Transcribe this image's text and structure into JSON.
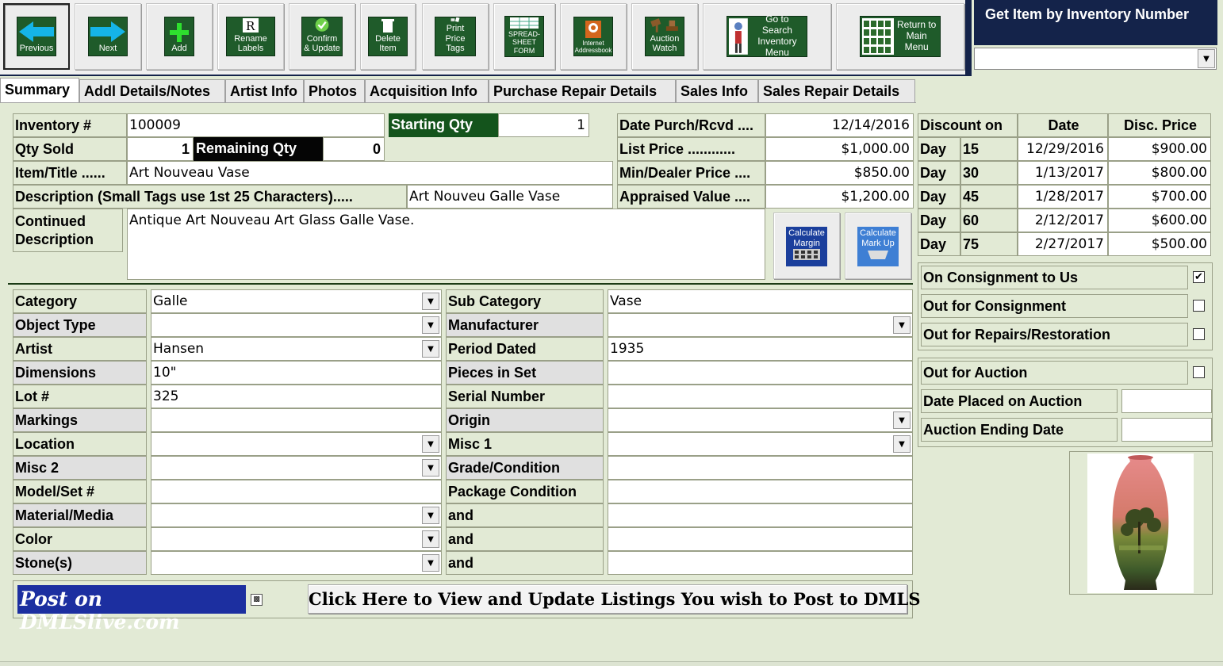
{
  "toolbar": {
    "buttons": [
      {
        "label": "Previous"
      },
      {
        "label": "Next"
      },
      {
        "label": "Add"
      },
      {
        "label": "Rename\nLabels"
      },
      {
        "label": "Confirm\n& Update"
      },
      {
        "label": "Delete\nItem"
      },
      {
        "label": "Print\nPrice Tags"
      },
      {
        "label": "SPREAD-\nSHEET\nFORM"
      },
      {
        "label": "Internet\nAddressbook"
      },
      {
        "label": "Auction\nWatch"
      },
      {
        "label": "Go to Search\nInventory\nMenu"
      },
      {
        "label": "Return to\nMain\nMenu"
      }
    ]
  },
  "get_item": {
    "title": "Get Item by Inventory Number",
    "value": ""
  },
  "tabs": [
    "Summary",
    "Addl Details/Notes",
    "Artist Info",
    "Photos",
    "Acquisition Info",
    "Purchase Repair Details",
    "Sales Info",
    "Sales Repair Details"
  ],
  "summary": {
    "inventory_label": "Inventory #",
    "inventory_value": "100009",
    "starting_qty_label": "Starting Qty",
    "starting_qty_value": "1",
    "qty_sold_label": "Qty Sold",
    "qty_sold_value": "1",
    "remaining_qty_label": "Remaining Qty",
    "remaining_qty_value": "0",
    "item_title_label": "Item/Title ......",
    "item_title_value": "Art Nouveau Vase",
    "description_label": "Description (Small Tags use 1st 25 Characters).....",
    "description_value": "Art Nouveu Galle Vase",
    "continued_label": "Continued\nDescription",
    "continued_value": "Antique Art Nouveau Art Glass Galle Vase.",
    "date_purch_label": "Date Purch/Rcvd ....",
    "date_purch_value": "12/14/2016",
    "list_price_label": "List  Price ............",
    "list_price_value": "$1,000.00",
    "min_price_label": "Min/Dealer Price ....",
    "min_price_value": "$850.00",
    "appraised_label": "Appraised Value ....",
    "appraised_value": "$1,200.00",
    "calc_margin": "Calculate\nMargin",
    "calc_markup": "Calculate\nMark Up"
  },
  "discount": {
    "headers": [
      "Discount on",
      "Date",
      "Disc. Price"
    ],
    "rows": [
      {
        "day_label": "Day",
        "days": "15",
        "date": "12/29/2016",
        "price": "$900.00"
      },
      {
        "day_label": "Day",
        "days": "30",
        "date": "1/13/2017",
        "price": "$800.00"
      },
      {
        "day_label": "Day",
        "days": "45",
        "date": "1/28/2017",
        "price": "$700.00"
      },
      {
        "day_label": "Day",
        "days": "60",
        "date": "2/12/2017",
        "price": "$600.00"
      },
      {
        "day_label": "Day",
        "days": "75",
        "date": "2/27/2017",
        "price": "$500.00"
      }
    ]
  },
  "status": {
    "on_consignment": {
      "label": "On Consignment to Us",
      "checked": "✔"
    },
    "out_consignment": {
      "label": "Out for Consignment",
      "checked": ""
    },
    "out_repairs": {
      "label": "Out for Repairs/Restoration",
      "checked": ""
    },
    "out_auction": {
      "label": "Out for Auction",
      "checked": ""
    },
    "date_placed_label": "Date Placed on Auction",
    "date_placed_value": "",
    "auction_end_label": "Auction Ending Date",
    "auction_end_value": ""
  },
  "details_left": [
    {
      "label": "Category",
      "value": "Galle",
      "combo": true
    },
    {
      "label": "Object Type",
      "value": "",
      "combo": true
    },
    {
      "label": "Artist",
      "value": "Hansen",
      "combo": true
    },
    {
      "label": "Dimensions",
      "value": "10\"",
      "combo": false
    },
    {
      "label": "Lot #",
      "value": "325",
      "combo": false
    },
    {
      "label": "Markings",
      "value": "",
      "combo": false
    },
    {
      "label": "Location",
      "value": "",
      "combo": true
    },
    {
      "label": "Misc 2",
      "value": "",
      "combo": true
    },
    {
      "label": "Model/Set #",
      "value": "",
      "combo": false
    },
    {
      "label": "Material/Media",
      "value": "",
      "combo": true
    },
    {
      "label": "Color",
      "value": "",
      "combo": true
    },
    {
      "label": "Stone(s)",
      "value": "",
      "combo": true
    }
  ],
  "details_right": [
    {
      "label": "Sub Category",
      "value": "Vase",
      "combo": false
    },
    {
      "label": "Manufacturer",
      "value": "",
      "combo": true
    },
    {
      "label": "Period Dated",
      "value": "1935",
      "combo": false
    },
    {
      "label": "Pieces in Set",
      "value": "",
      "combo": false
    },
    {
      "label": "Serial Number",
      "value": "",
      "combo": false
    },
    {
      "label": "Origin",
      "value": "",
      "combo": true
    },
    {
      "label": "Misc 1",
      "value": "",
      "combo": true
    },
    {
      "label": "Grade/Condition",
      "value": "",
      "combo": false
    },
    {
      "label": "Package Condition",
      "value": "",
      "combo": false
    },
    {
      "label": "and",
      "value": "",
      "combo": false
    },
    {
      "label": "and",
      "value": "",
      "combo": false
    },
    {
      "label": "and",
      "value": "",
      "combo": false
    }
  ],
  "post": {
    "logo": "Post on DMLSlive.com",
    "checkbox": "▩",
    "button": "Click Here to View and Update Listings You wish to Post to DMLS"
  },
  "icons": {
    "previous": "arrow-left-icon",
    "next": "arrow-right-icon",
    "add": "plus-icon",
    "rename": "rename-icon",
    "confirm": "checkmark-icon",
    "delete": "trash-icon",
    "print": "printer-icon",
    "spreadsheet": "spreadsheet-icon",
    "internet": "globe-icon",
    "auction": "gavel-icon",
    "search": "search-person-icon",
    "main": "grid-menu-icon"
  },
  "colors": {
    "header_bg": "#14234a",
    "button_face": "#1f5b2a",
    "form_bg": "#e2ead5",
    "calc_face": "#1b3f9c",
    "arrow": "#15b4e8"
  }
}
